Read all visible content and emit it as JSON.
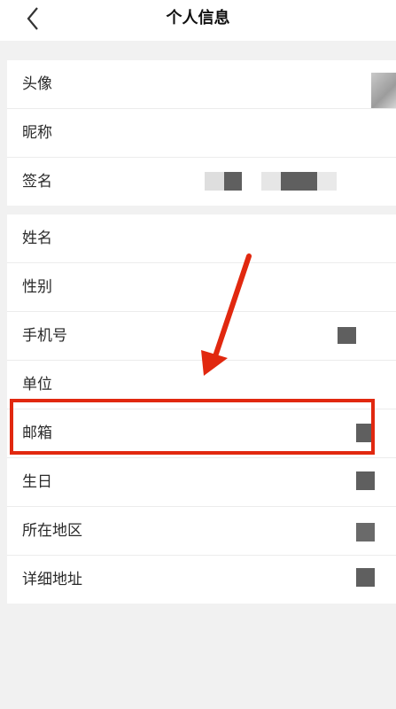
{
  "header": {
    "title": "个人信息",
    "back_icon": "chevron-left-icon"
  },
  "profile": {
    "items": [
      {
        "label": "头像"
      },
      {
        "label": "昵称"
      },
      {
        "label": "签名"
      }
    ]
  },
  "details": {
    "items": [
      {
        "label": "姓名"
      },
      {
        "label": "性别"
      },
      {
        "label": "手机号"
      },
      {
        "label": "单位"
      },
      {
        "label": "邮箱"
      },
      {
        "label": "生日"
      },
      {
        "label": "所在地区"
      },
      {
        "label": "详细地址"
      }
    ]
  },
  "annotation": {
    "highlight_color": "#e1280f",
    "arrow_color": "#e1280f",
    "highlighted_item": "邮箱"
  }
}
